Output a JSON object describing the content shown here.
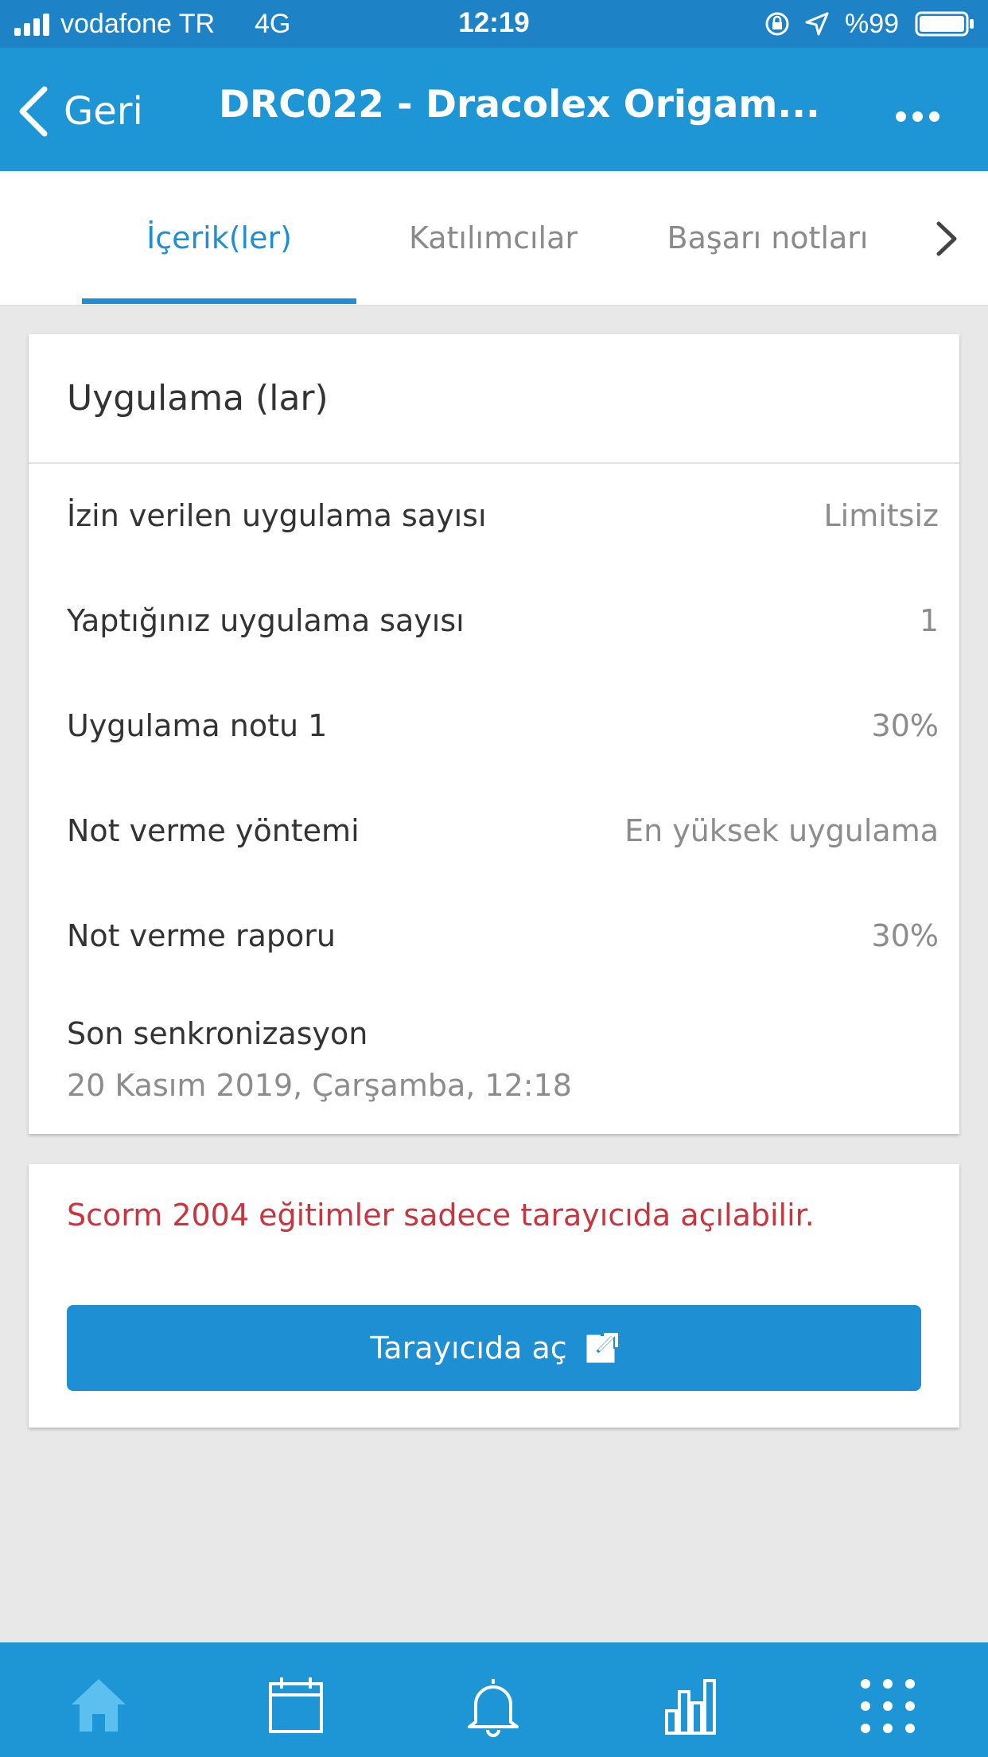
{
  "status_bar": {
    "carrier": "vodafone TR",
    "network": "4G",
    "time": "12:19",
    "battery_percent": "%99",
    "icons": [
      "signal-icon",
      "orientation-lock-icon",
      "location-icon",
      "battery-icon"
    ]
  },
  "nav": {
    "back_label": "Geri",
    "title": "DRC022 - Dracolex Origam...",
    "icons": [
      "chevron-left-icon",
      "more-icon"
    ]
  },
  "tabs": {
    "items": [
      {
        "label": "İçerik(ler)",
        "active": true
      },
      {
        "label": "Katılımcılar",
        "active": false
      },
      {
        "label": "Başarı notları",
        "active": false
      }
    ],
    "next_icon": "chevron-right-icon"
  },
  "attempts_card": {
    "title": "Uygulama (lar)",
    "rows": [
      {
        "label": "İzin verilen uygulama sayısı",
        "value": "Limitsiz"
      },
      {
        "label": "Yaptığınız uygulama sayısı",
        "value": "1"
      },
      {
        "label": "Uygulama notu 1",
        "value": "30%"
      },
      {
        "label": "Not verme yöntemi",
        "value": "En yüksek uygulama"
      },
      {
        "label": "Not verme raporu",
        "value": "30%"
      }
    ],
    "sync_label": "Son senkronizasyon",
    "sync_value": "20 Kasım 2019, Çarşamba, 12:18"
  },
  "browser_card": {
    "warning": "Scorm 2004 eğitimler sadece tarayıcıda açılabilir.",
    "button_label": "Tarayıcıda aç",
    "button_icon": "external-link-icon"
  },
  "bottom_bar": {
    "items": [
      "home-icon",
      "calendar-icon",
      "bell-icon",
      "bar-chart-icon",
      "apps-grid-icon"
    ],
    "active": "home-icon"
  },
  "colors": {
    "primary": "#1e96d6",
    "accent": "#1e8fd2",
    "warning": "#c9343f",
    "active_tab_icon": "#5bc0f0"
  }
}
